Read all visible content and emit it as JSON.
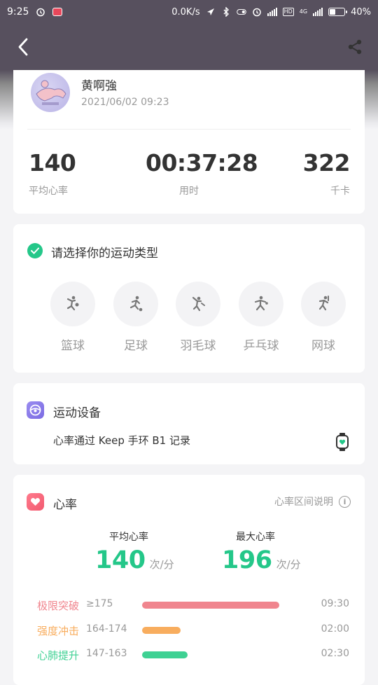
{
  "status_bar": {
    "time": "9:25",
    "network_speed": "0.0K/s",
    "network_type": "4G",
    "hd_label": "HD",
    "battery": "40%",
    "battery_level": 0.4
  },
  "nav": {
    "back_icon": "chevron-left-icon",
    "share_icon": "share-icon"
  },
  "profile": {
    "name": "黄啊強",
    "datetime": "2021/06/02 09:23",
    "stats": [
      {
        "value": "140",
        "label": "平均心率"
      },
      {
        "value": "00:37:28",
        "label": "用时"
      },
      {
        "value": "322",
        "label": "千卡"
      }
    ]
  },
  "sport_type": {
    "title": "请选择你的运动类型",
    "options": [
      {
        "label": "篮球",
        "icon": "basketball-player-icon"
      },
      {
        "label": "足球",
        "icon": "football-player-icon"
      },
      {
        "label": "羽毛球",
        "icon": "badminton-player-icon"
      },
      {
        "label": "乒乓球",
        "icon": "table-tennis-player-icon"
      },
      {
        "label": "网球",
        "icon": "tennis-player-icon"
      }
    ]
  },
  "device": {
    "title": "运动设备",
    "description": "心率通过 Keep 手环 B1 记录",
    "icon": "device-icon",
    "watch_icon": "smart-band-icon"
  },
  "heart_rate": {
    "title": "心率",
    "explain_link": "心率区间说明",
    "average": {
      "label": "平均心率",
      "value": "140",
      "unit": "次/分"
    },
    "max": {
      "label": "最大心率",
      "value": "196",
      "unit": "次/分"
    },
    "zones": [
      {
        "name": "极限突破",
        "range": "≥175",
        "time": "09:30",
        "color": "#f0858e",
        "fraction": 1.0
      },
      {
        "name": "强度冲击",
        "range": "164-174",
        "time": "02:00",
        "color": "#f8ad5e",
        "fraction": 0.28
      },
      {
        "name": "心肺提升",
        "range": "147-163",
        "time": "02:30",
        "color": "#3ed193",
        "fraction": 0.33
      }
    ]
  },
  "colors": {
    "accent_green": "#24c789",
    "header_bg": "#57505e"
  }
}
